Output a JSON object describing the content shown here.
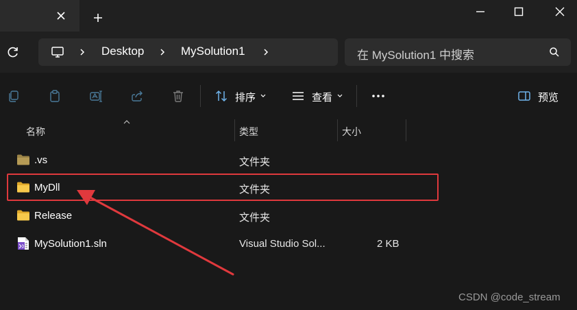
{
  "window": {
    "tab_close_icon": "close-icon",
    "new_tab_icon": "plus-icon",
    "controls": [
      "minimize-icon",
      "maximize-icon",
      "close-icon"
    ]
  },
  "address": {
    "refresh_icon": "refresh-icon",
    "root_icon": "computer-icon",
    "crumbs": [
      "Desktop",
      "MySolution1"
    ]
  },
  "search": {
    "placeholder": "在 MySolution1 中搜索",
    "icon": "search-icon"
  },
  "toolbar": {
    "sort_label": "排序",
    "view_label": "查看",
    "preview_label": "预览",
    "icons": [
      "copy-icon",
      "paste-icon",
      "rename-icon",
      "share-icon",
      "delete-icon",
      "sort-icon",
      "view-icon",
      "more-icon",
      "preview-pane-icon"
    ]
  },
  "columns": {
    "name": "名称",
    "type": "类型",
    "size": "大小"
  },
  "files": [
    {
      "name": ".vs",
      "type": "文件夹",
      "size": "",
      "icon": "folder-dim-icon"
    },
    {
      "name": "MyDll",
      "type": "文件夹",
      "size": "",
      "icon": "folder-icon"
    },
    {
      "name": "Release",
      "type": "文件夹",
      "size": "",
      "icon": "folder-icon"
    },
    {
      "name": "MySolution1.sln",
      "type": "Visual Studio Sol...",
      "size": "2 KB",
      "icon": "visual-studio-solution-icon"
    }
  ],
  "annotation": {
    "highlight_color": "#e0393d",
    "highlighted_item": "MyDll"
  },
  "watermark": "CSDN @code_stream"
}
